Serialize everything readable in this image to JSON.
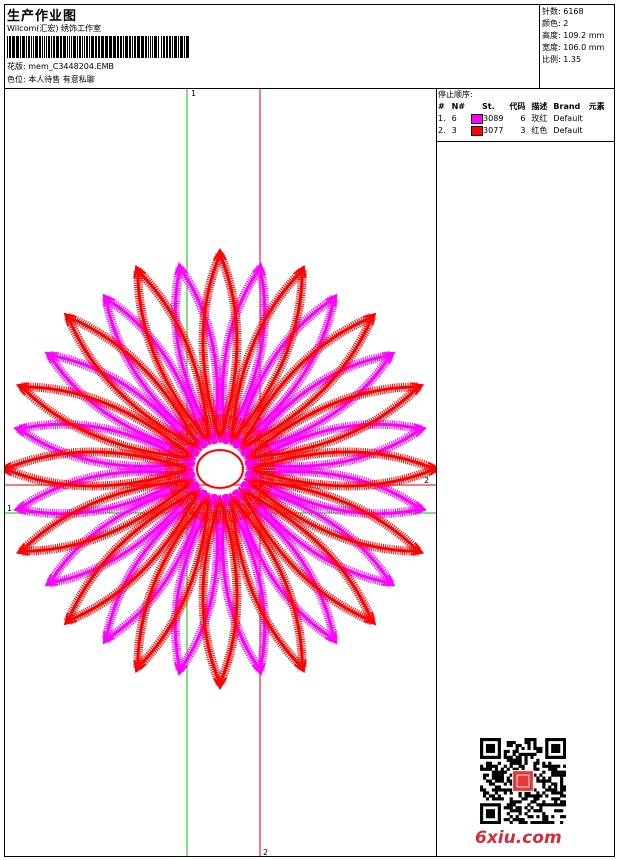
{
  "header": {
    "title": "生产作业图",
    "studio": "Wilcom(汇宏) 绣饰工作室",
    "pattern_label": "花版:",
    "pattern_file": "mem_C3448204.EMB",
    "color_label": "色位:",
    "color_note": "本人待售 有意私聊"
  },
  "stats": [
    {
      "label": "针数:",
      "value": "6168"
    },
    {
      "label": "颜色:",
      "value": "2"
    },
    {
      "label": "高度:",
      "value": "109.2 mm"
    },
    {
      "label": "宽度:",
      "value": "106.0 mm"
    },
    {
      "label": "比例:",
      "value": "1.35"
    }
  ],
  "stop_sequence": {
    "title": "停止顺序:",
    "columns": [
      "#",
      "N#",
      "St.",
      "代码",
      "描述",
      "Brand",
      "元素"
    ],
    "rows": [
      {
        "index": "1.",
        "needle": "6",
        "stitch": "3089",
        "code": "6",
        "desc": "玫红",
        "brand": "Default",
        "color": "#ff00ff"
      },
      {
        "index": "2.",
        "needle": "3",
        "stitch": "3077",
        "code": "3",
        "desc": "红色",
        "brand": "Default",
        "color": "#ff0000"
      }
    ]
  },
  "axes": {
    "green_v_label": "1",
    "green_h_label": "1",
    "red_v_label": "2",
    "red_h_label": "2"
  },
  "colors": {
    "magenta": "#ff00ff",
    "red": "#ff0000",
    "green_axis": "#00c000",
    "red_axis": "#e00000"
  },
  "watermark": {
    "site": "6xiu.com"
  }
}
